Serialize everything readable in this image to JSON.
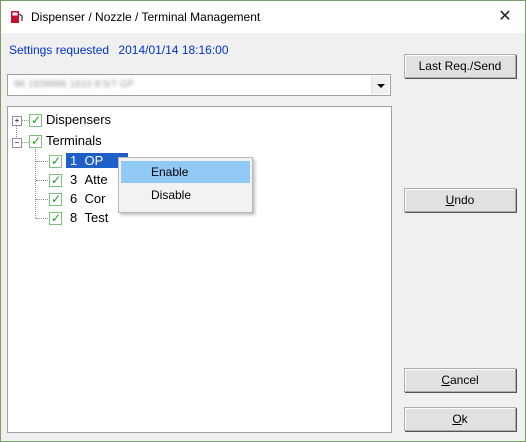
{
  "window": {
    "title": "Dispenser / Nozzle / Terminal  Management",
    "close_glyph": "✕",
    "icon": "dispenser-icon"
  },
  "settings": {
    "label": "Settings requested",
    "timestamp": "2014/01/14 18:16:00",
    "color": "#0033cc"
  },
  "combo": {
    "value": "96 1839866 1610 8:5/7 GP"
  },
  "tree": {
    "dispensers": {
      "label": "Dispensers",
      "expander": "+"
    },
    "terminals": {
      "label": "Terminals",
      "expander": "−"
    },
    "items": [
      {
        "number": "1",
        "name": "OP"
      },
      {
        "number": "3",
        "name": "Atte"
      },
      {
        "number": "6",
        "name": "Cor"
      },
      {
        "number": "8",
        "name": "Test"
      }
    ]
  },
  "context_menu": {
    "items": [
      {
        "label": "Enable",
        "highlighted": true
      },
      {
        "label": "Disable",
        "highlighted": false
      }
    ]
  },
  "buttons": {
    "last_req_send": "Last Req./Send",
    "undo_prefix": "",
    "undo_mnemonic": "U",
    "undo_rest": "ndo",
    "cancel_mnemonic": "C",
    "cancel_rest": "ancel",
    "ok_mnemonic": "O",
    "ok_rest": "k"
  }
}
